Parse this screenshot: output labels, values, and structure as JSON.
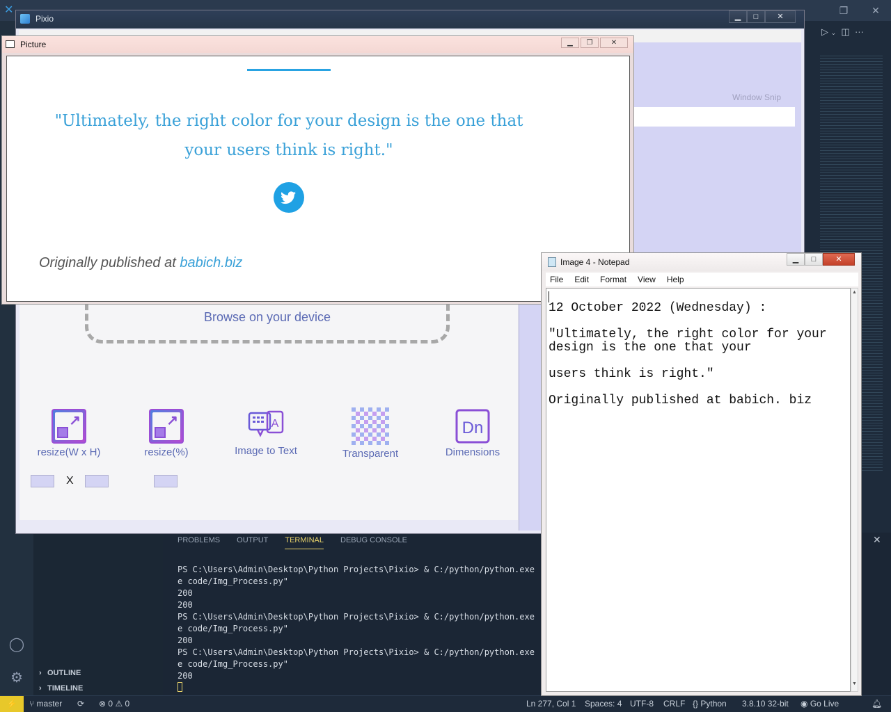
{
  "pixio": {
    "title": "Pixio",
    "browse_label": "Browse on your device",
    "tools": [
      {
        "label": "resize(W x H)",
        "icon": "resize-icon"
      },
      {
        "label": "resize(%)",
        "icon": "resize-percent-icon"
      },
      {
        "label": "Image to Text",
        "icon": "image-to-text-icon"
      },
      {
        "label": "Transparent",
        "icon": "transparent-icon"
      },
      {
        "label": "Dimensions",
        "icon": "dimensions-icon"
      }
    ],
    "x_label": "X",
    "winsnip_label": "Window Snip"
  },
  "picture": {
    "title": "Picture",
    "quote": "\"Ultimately, the right color for your design is the one that your users think is right.\"",
    "published_prefix": "Originally published at ",
    "published_link": "babich.biz"
  },
  "notepad": {
    "title": "Image 4 - Notepad",
    "menu": [
      "File",
      "Edit",
      "Format",
      "View",
      "Help"
    ],
    "content": "12 October 2022 (Wednesday) :\n\n\"Ultimately, the right color for your design is the one that your\n\nusers think is right.\"\n\nOriginally published at babich. biz"
  },
  "vscode": {
    "sidebar_sections": [
      "OUTLINE",
      "TIMELINE"
    ],
    "panel_tabs": [
      "PROBLEMS",
      "OUTPUT",
      "TERMINAL",
      "DEBUG CONSOLE"
    ],
    "active_panel_tab": "TERMINAL",
    "terminal_text": "PS C:\\Users\\Admin\\Desktop\\Python Projects\\Pixio> & C:/python/python.exe \"c\ne code/Img_Process.py\"\n200\n200\nPS C:\\Users\\Admin\\Desktop\\Python Projects\\Pixio> & C:/python/python.exe \"c\ne code/Img_Process.py\"\n200\nPS C:\\Users\\Admin\\Desktop\\Python Projects\\Pixio> & C:/python/python.exe \"c\ne code/Img_Process.py\"\n200\n",
    "status": {
      "branch": "master",
      "errors": "0",
      "warnings": "0",
      "position": "Ln 277, Col 1",
      "spaces": "Spaces: 4",
      "encoding": "UTF-8",
      "eol": "CRLF",
      "language": "Python",
      "interpreter": "3.8.10 32-bit",
      "go_live": "Go Live"
    }
  },
  "colors": {
    "accent_blue": "#29a3e2",
    "quote_blue": "#3aa1d8",
    "pixio_purple": "#5b6ab4",
    "status_remote": "#e8c82a"
  }
}
